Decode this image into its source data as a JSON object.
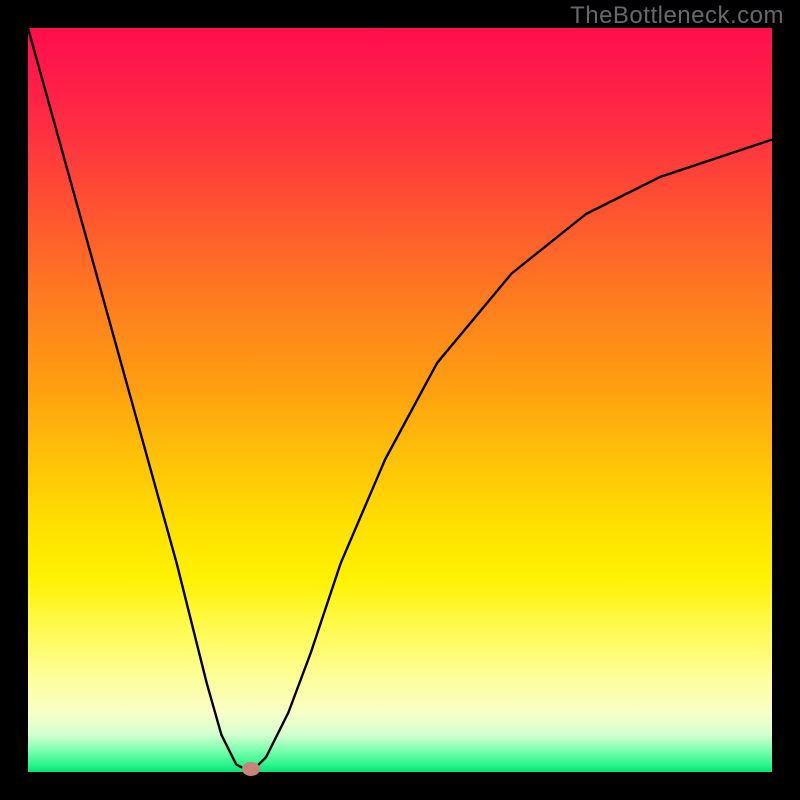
{
  "watermark": "TheBottleneck.com",
  "colors": {
    "background": "#000000",
    "gradient_top": "#ff0f4c",
    "gradient_mid": "#ffe000",
    "gradient_bottom": "#00e678",
    "curve": "#000000",
    "dot": "#c9837a",
    "watermark": "#66696b"
  },
  "chart_data": {
    "type": "line",
    "title": "",
    "xlabel": "",
    "ylabel": "",
    "xlim": [
      0,
      1
    ],
    "ylim": [
      0,
      1
    ],
    "series": [
      {
        "name": "bottleneck-curve",
        "x": [
          0.0,
          0.05,
          0.1,
          0.15,
          0.2,
          0.24,
          0.26,
          0.28,
          0.3,
          0.32,
          0.35,
          0.38,
          0.42,
          0.48,
          0.55,
          0.65,
          0.75,
          0.85,
          1.0
        ],
        "values": [
          1.0,
          0.82,
          0.64,
          0.46,
          0.28,
          0.12,
          0.05,
          0.01,
          0.0,
          0.02,
          0.08,
          0.16,
          0.28,
          0.42,
          0.55,
          0.67,
          0.75,
          0.8,
          0.85
        ]
      }
    ],
    "marker": {
      "x": 0.3,
      "y": 0.0
    }
  }
}
